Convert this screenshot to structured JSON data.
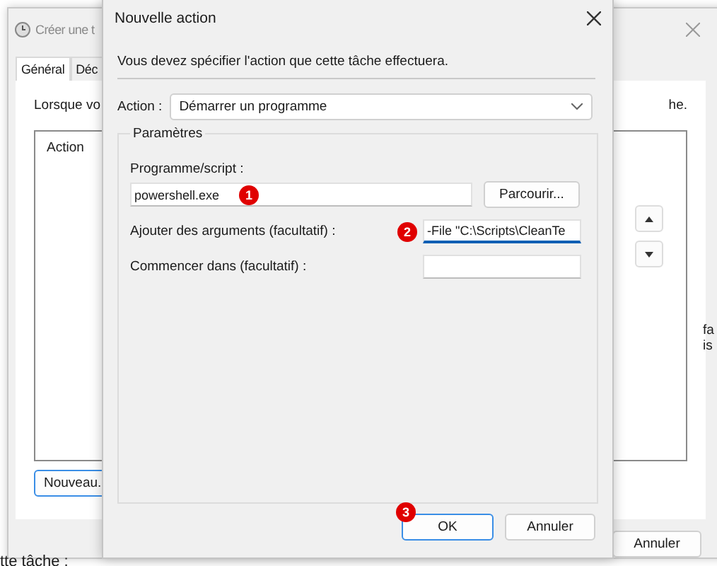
{
  "background_window": {
    "title": "Créer une t",
    "tabs": [
      {
        "label": "Général",
        "selected": true
      },
      {
        "label": "Déc",
        "selected": false
      }
    ],
    "intro_left": "Lorsque vo",
    "intro_right": "he.",
    "list_header": "Action",
    "new_button": "Nouveau.",
    "cancel_button": "Annuler",
    "side_text": [
      "fa",
      "is"
    ],
    "footer_text": "tte tâche :"
  },
  "dialog": {
    "title": "Nouvelle action",
    "instruction": "Vous devez spécifier l'action que cette tâche effectuera.",
    "action_label": "Action :",
    "action_value": "Démarrer un programme",
    "group_title": "Paramètres",
    "fields": [
      {
        "label": "Programme/script :",
        "value": "powershell.exe",
        "focused": false,
        "badge": "1"
      },
      {
        "label": "Ajouter des arguments (facultatif) :",
        "value": "-File \"C:\\Scripts\\CleanTe",
        "focused": true,
        "badge": "2"
      },
      {
        "label": "Commencer dans (facultatif) :",
        "focused": false
      }
    ],
    "browse_button": "Parcourir...",
    "ok_button": "OK",
    "ok_badge": "3",
    "cancel_button": "Annuler"
  }
}
